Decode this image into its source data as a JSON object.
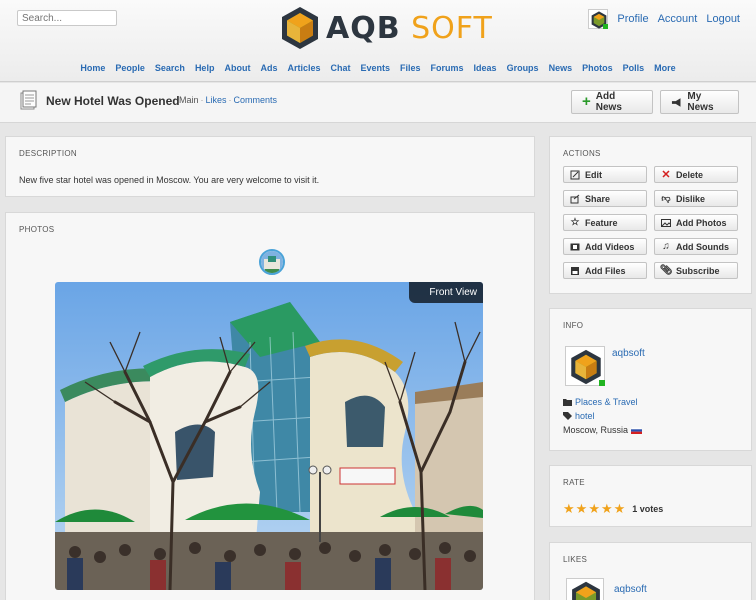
{
  "header": {
    "search_placeholder": "Search...",
    "logo_part1": "AQB",
    "logo_part2": "SOFT",
    "user_nav": [
      "Profile",
      "Account",
      "Logout"
    ]
  },
  "nav": [
    "Home",
    "People",
    "Search",
    "Help",
    "About",
    "Ads",
    "Articles",
    "Chat",
    "Events",
    "Files",
    "Forums",
    "Ideas",
    "Groups",
    "News",
    "Photos",
    "Polls",
    "More"
  ],
  "page": {
    "title": "New Hotel Was Opened",
    "breadcrumb": [
      "Main",
      "Likes",
      "Comments"
    ],
    "add_news": "Add News",
    "my_news": "My News"
  },
  "description": {
    "heading": "DESCRIPTION",
    "text": "New five star hotel was opened in Moscow. You are very welcome to visit it."
  },
  "photos": {
    "heading": "PHOTOS",
    "caption": "Front View"
  },
  "actions": {
    "heading": "ACTIONS",
    "items": [
      "Edit",
      "Delete",
      "Share",
      "Dislike",
      "Feature",
      "Add Photos",
      "Add Videos",
      "Add Sounds",
      "Add Files",
      "Subscribe"
    ]
  },
  "info": {
    "heading": "INFO",
    "author": "aqbsoft",
    "category": "Places & Travel",
    "tag": "hotel",
    "location": "Moscow, Russia"
  },
  "rate": {
    "heading": "RATE",
    "stars": 5,
    "votes": "1 votes"
  },
  "likes": {
    "heading": "LIKES",
    "user": "aqbsoft"
  },
  "colors": {
    "accent": "#f0a21b",
    "link": "#2a6bb3",
    "online": "#21b421",
    "delete": "#d42020"
  }
}
